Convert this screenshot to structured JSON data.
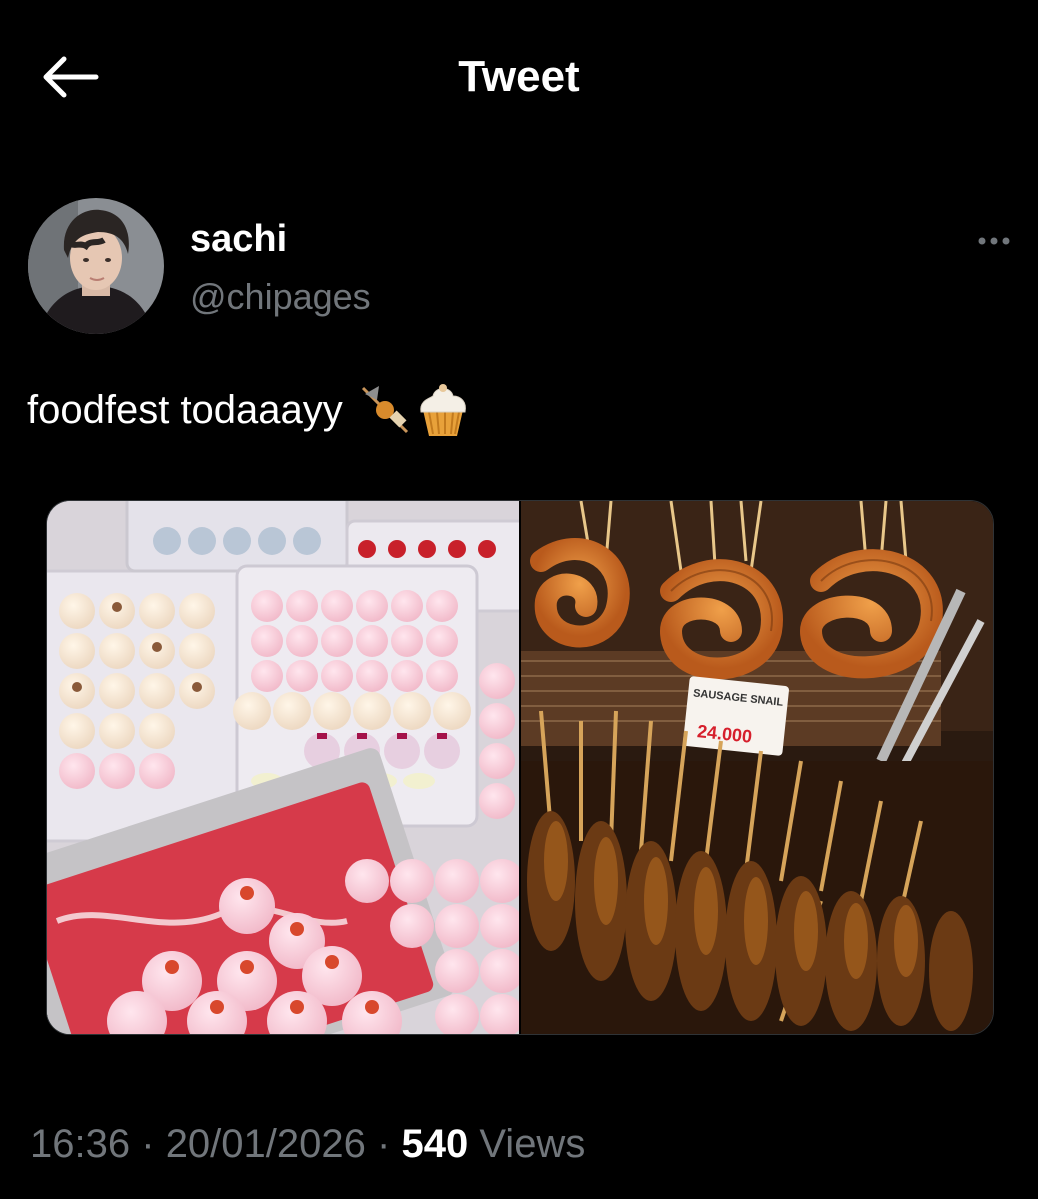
{
  "header": {
    "title": "Tweet",
    "back_icon": "arrow-left-icon"
  },
  "author": {
    "display_name": "sachi",
    "handle": "@chipages"
  },
  "menu": {
    "icon": "more-horizontal-icon"
  },
  "tweet": {
    "text": "foodfest todaaayy",
    "emojis": [
      "oden-skewer-emoji",
      "cupcake-emoji"
    ]
  },
  "media": [
    {
      "kind": "photo",
      "subject": "mochi-trays"
    },
    {
      "kind": "photo",
      "subject": "grilled-sausages",
      "sign_title": "SAUSAGE SNAIL",
      "sign_price": "24.000"
    }
  ],
  "meta": {
    "time": "16:36",
    "date": "20/01/2026",
    "views_count": "540",
    "views_label": "Views",
    "sep": "·"
  },
  "colors": {
    "background": "#000000",
    "primary_text": "#ffffff",
    "secondary_text": "#71767b"
  }
}
